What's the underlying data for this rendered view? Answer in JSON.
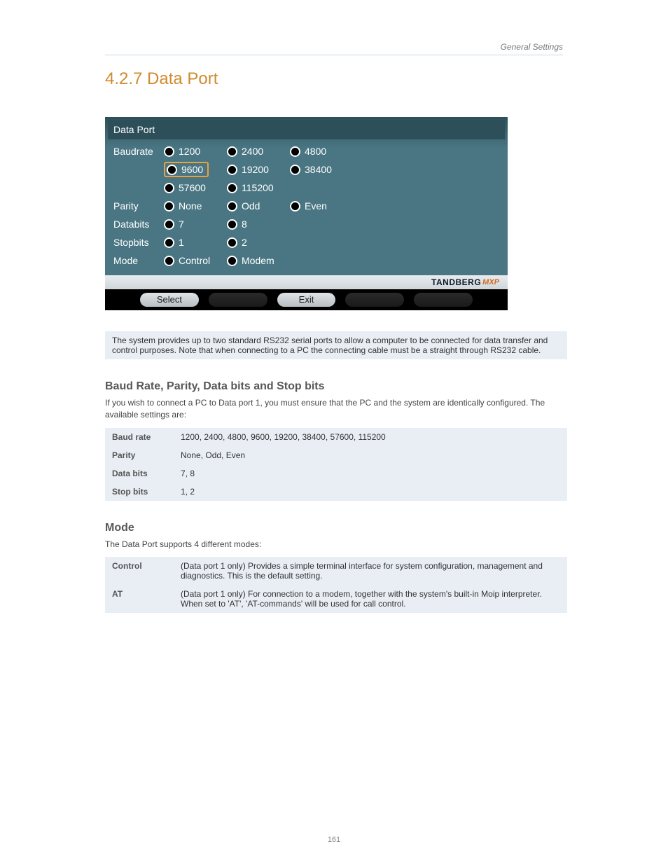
{
  "page": {
    "category": "General Settings",
    "heading": "4.2.7 Data Port",
    "number": "161"
  },
  "screenshot": {
    "title": "Data Port",
    "brand_main": "TANDBERG",
    "brand_sub": "MXP",
    "buttons": {
      "select": "Select",
      "exit": "Exit"
    },
    "rows": {
      "baudrate": {
        "label": "Baudrate",
        "r1": {
          "a": "1200",
          "b": "2400",
          "c": "4800"
        },
        "r2": {
          "a": "9600",
          "b": "19200",
          "c": "38400"
        },
        "r3": {
          "a": "57600",
          "b": "115200"
        }
      },
      "parity": {
        "label": "Parity",
        "a": "None",
        "b": "Odd",
        "c": "Even"
      },
      "databits": {
        "label": "Databits",
        "a": "7",
        "b": "8"
      },
      "stopbits": {
        "label": "Stopbits",
        "a": "1",
        "b": "2"
      },
      "mode": {
        "label": "Mode",
        "a": "Control",
        "b": "Modem"
      }
    }
  },
  "intro": {
    "text": "The system provides up to two standard RS232 serial ports to allow a computer to be connected for data transfer and control purposes. Note that when connecting to a PC the connecting cable must be a straight through RS232 cable."
  },
  "baud_section": {
    "heading": "Baud Rate, Parity, Data bits and Stop bits",
    "text": "If you wish to connect a PC to Data port 1, you must ensure that the PC and the system are identically configured. The available settings are:"
  },
  "baud_table": {
    "baud": {
      "k": "Baud rate",
      "v": "1200, 2400, 4800, 9600, 19200, 38400, 57600, 115200"
    },
    "parity": {
      "k": "Parity",
      "v": "None, Odd, Even"
    },
    "databits": {
      "k": "Data bits",
      "v": "7, 8"
    },
    "stopbits": {
      "k": "Stop bits",
      "v": "1, 2"
    }
  },
  "mode_section": {
    "heading": "Mode",
    "lead": "The Data Port supports 4 different modes:",
    "table": {
      "control": {
        "k": "Control",
        "v": "(Data port 1 only) Provides a simple terminal interface for system configuration, management and diagnostics. This is the default setting."
      },
      "at": {
        "k": "AT",
        "v": "(Data port 1 only) For connection to a modem, together with the system's built-in Moip interpreter. When set to 'AT', 'AT-commands' will be used for call control."
      }
    }
  }
}
